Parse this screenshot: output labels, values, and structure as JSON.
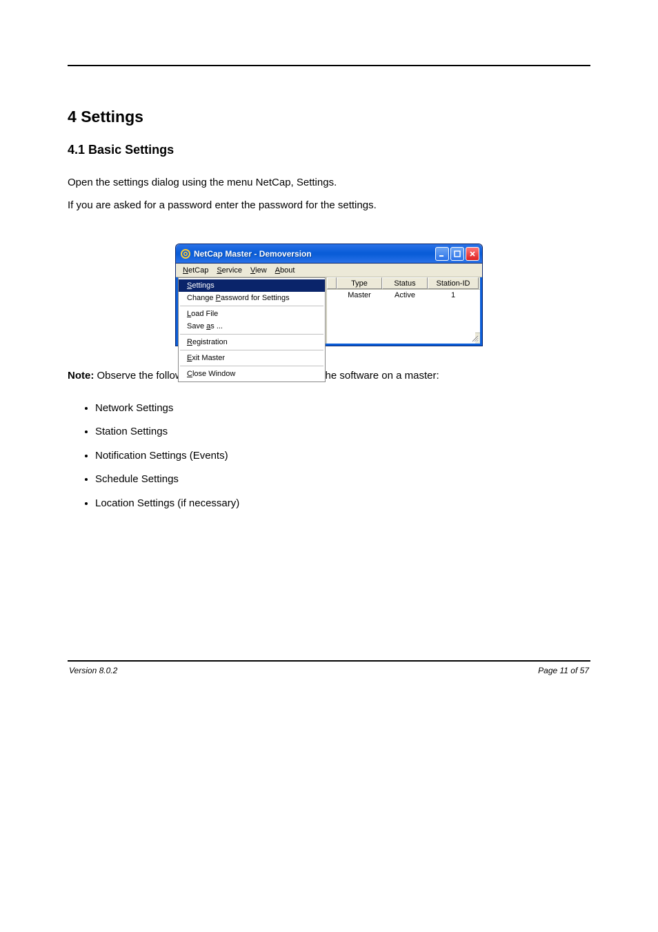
{
  "doc": {
    "section_number": "4",
    "section_title": "Settings",
    "subsection_number": "4.1",
    "subsection_title": "Basic Settings",
    "intro_1": "Open the settings dialog using the menu NetCap, Settings.",
    "intro_2": "If you are asked for a password enter the password for the settings.",
    "note_label": "Note:",
    "note_body": "Observe the following sequence when setting up the software on a master:",
    "bullets": [
      "Network Settings",
      "Station Settings",
      "Notification Settings (Events)",
      "Schedule Settings",
      "Location Settings (if necessary)"
    ],
    "footer_left": "Version 8.0.2",
    "footer_right": "Page 11 of 57"
  },
  "window": {
    "title": "NetCap Master - Demoversion",
    "icon_name": "at-sign-icon",
    "menubar": {
      "items": [
        {
          "label": "NetCap",
          "hotkey": "N"
        },
        {
          "label": "Service",
          "hotkey": "S"
        },
        {
          "label": "View",
          "hotkey": "V"
        },
        {
          "label": "About",
          "hotkey": "A"
        }
      ]
    },
    "dropdown": {
      "items": [
        {
          "label": "Settings",
          "hotkey": "S",
          "highlighted": true
        },
        {
          "label": "Change Password for Settings",
          "hotkey": "P"
        },
        {
          "sep": true
        },
        {
          "label": "Load File",
          "hotkey": "L"
        },
        {
          "label": "Save as ...",
          "hotkey": "a"
        },
        {
          "sep": true
        },
        {
          "label": "Registration",
          "hotkey": "R"
        },
        {
          "sep": true
        },
        {
          "label": "Exit Master",
          "hotkey": "E"
        },
        {
          "sep": true
        },
        {
          "label": "Close Window",
          "hotkey": "C"
        }
      ]
    },
    "table": {
      "headers": [
        "Type",
        "Status",
        "Station-ID"
      ],
      "row": {
        "type": "Master",
        "status": "Active",
        "station_id": "1"
      }
    }
  }
}
